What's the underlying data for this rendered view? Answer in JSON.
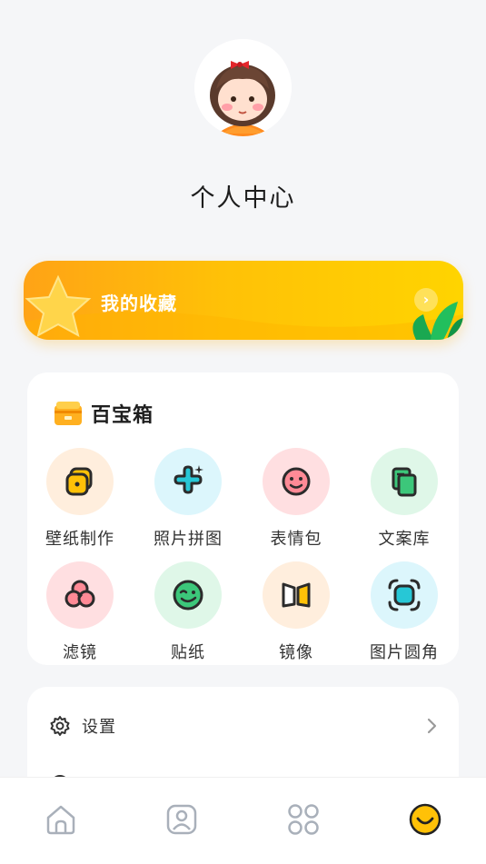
{
  "profile": {
    "title": "个人中心"
  },
  "favorites": {
    "label": "我的收藏",
    "arrow": "›"
  },
  "toolbox": {
    "title": "百宝箱",
    "items": [
      {
        "label": "壁纸制作",
        "icon": "wallpaper-icon",
        "bg": "#ffeedd"
      },
      {
        "label": "照片拼图",
        "icon": "puzzle-icon",
        "bg": "#dcf6fc"
      },
      {
        "label": "表情包",
        "icon": "smiley-icon",
        "bg": "#ffdfe1"
      },
      {
        "label": "文案库",
        "icon": "copy-library-icon",
        "bg": "#dff7e8"
      },
      {
        "label": "滤镜",
        "icon": "filter-icon",
        "bg": "#ffdfe1"
      },
      {
        "label": "贴纸",
        "icon": "sticker-icon",
        "bg": "#dff7e8"
      },
      {
        "label": "镜像",
        "icon": "mirror-icon",
        "bg": "#ffeedd"
      },
      {
        "label": "图片圆角",
        "icon": "rounded-corner-icon",
        "bg": "#dcf6fc"
      }
    ]
  },
  "settings": {
    "label": "设置"
  },
  "nav": {
    "items": [
      "home-icon",
      "profile-card-icon",
      "apps-grid-icon",
      "smile-face-icon"
    ],
    "active_index": 3
  },
  "colors": {
    "accent": "#ffc107",
    "icon_stroke": "#2b2b2b"
  }
}
